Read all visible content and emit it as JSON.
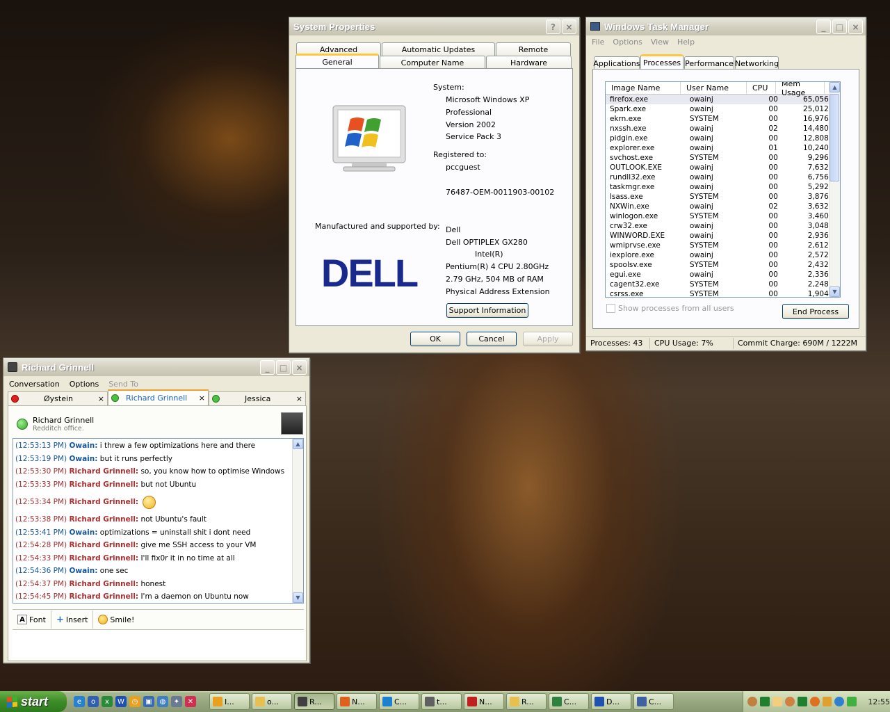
{
  "system_properties": {
    "title": "System Properties",
    "tabs_row1": [
      "Advanced",
      "Automatic Updates",
      "Remote"
    ],
    "tabs_row2": [
      "General",
      "Computer Name",
      "Hardware"
    ],
    "active_tab": "General",
    "system_label": "System:",
    "os_name": "Microsoft Windows XP",
    "os_edition": "Professional",
    "os_version": "Version 2002",
    "os_sp": "Service Pack 3",
    "registered_label": "Registered to:",
    "registered_user": "pccguest",
    "product_id": "76487-OEM-0011903-00102",
    "manufacturer_label": "Manufactured and supported by:",
    "manufacturer": "Dell",
    "model": "Dell OPTIPLEX GX280",
    "cpu_vendor": "Intel(R)",
    "cpu": "Pentium(R) 4 CPU 2.80GHz",
    "ram": "2.79 GHz, 504 MB of RAM",
    "pae": "Physical Address Extension",
    "logo_text": "DELL",
    "support_btn": "Support Information",
    "ok_btn": "OK",
    "cancel_btn": "Cancel",
    "apply_btn": "Apply",
    "help_icon": "?",
    "close_icon": "×"
  },
  "task_manager": {
    "title": "Windows Task Manager",
    "menu": [
      "File",
      "Options",
      "View",
      "Help"
    ],
    "tabs": [
      "Applications",
      "Processes",
      "Performance",
      "Networking"
    ],
    "active_tab": "Processes",
    "columns": [
      "Image Name",
      "User Name",
      "CPU",
      "Mem Usage"
    ],
    "processes": [
      {
        "name": "firefox.exe",
        "user": "owainj",
        "cpu": "00",
        "mem": "65,056 K"
      },
      {
        "name": "Spark.exe",
        "user": "owainj",
        "cpu": "00",
        "mem": "25,012 K"
      },
      {
        "name": "ekrn.exe",
        "user": "SYSTEM",
        "cpu": "00",
        "mem": "16,976 K"
      },
      {
        "name": "nxssh.exe",
        "user": "owainj",
        "cpu": "02",
        "mem": "14,480 K"
      },
      {
        "name": "pidgin.exe",
        "user": "owainj",
        "cpu": "00",
        "mem": "12,808 K"
      },
      {
        "name": "explorer.exe",
        "user": "owainj",
        "cpu": "01",
        "mem": "10,240 K"
      },
      {
        "name": "svchost.exe",
        "user": "SYSTEM",
        "cpu": "00",
        "mem": "9,296 K"
      },
      {
        "name": "OUTLOOK.EXE",
        "user": "owainj",
        "cpu": "00",
        "mem": "7,632 K"
      },
      {
        "name": "rundll32.exe",
        "user": "owainj",
        "cpu": "00",
        "mem": "6,756 K"
      },
      {
        "name": "taskmgr.exe",
        "user": "owainj",
        "cpu": "00",
        "mem": "5,292 K"
      },
      {
        "name": "lsass.exe",
        "user": "SYSTEM",
        "cpu": "00",
        "mem": "3,876 K"
      },
      {
        "name": "NXWin.exe",
        "user": "owainj",
        "cpu": "02",
        "mem": "3,632 K"
      },
      {
        "name": "winlogon.exe",
        "user": "SYSTEM",
        "cpu": "00",
        "mem": "3,460 K"
      },
      {
        "name": "crw32.exe",
        "user": "owainj",
        "cpu": "00",
        "mem": "3,048 K"
      },
      {
        "name": "WINWORD.EXE",
        "user": "owainj",
        "cpu": "00",
        "mem": "2,936 K"
      },
      {
        "name": "wmiprvse.exe",
        "user": "SYSTEM",
        "cpu": "00",
        "mem": "2,612 K"
      },
      {
        "name": "iexplore.exe",
        "user": "owainj",
        "cpu": "00",
        "mem": "2,572 K"
      },
      {
        "name": "spoolsv.exe",
        "user": "SYSTEM",
        "cpu": "00",
        "mem": "2,432 K"
      },
      {
        "name": "egui.exe",
        "user": "owainj",
        "cpu": "00",
        "mem": "2,336 K"
      },
      {
        "name": "cagent32.exe",
        "user": "SYSTEM",
        "cpu": "00",
        "mem": "2,248 K"
      },
      {
        "name": "csrss.exe",
        "user": "SYSTEM",
        "cpu": "00",
        "mem": "1,904 K"
      }
    ],
    "show_all_label": "Show processes from all users",
    "end_process_btn": "End Process",
    "status_processes": "Processes: 43",
    "status_cpu": "CPU Usage: 7%",
    "status_commit": "Commit Charge: 690M / 1222M"
  },
  "chat": {
    "title": "Richard Grinnell",
    "menu": [
      "Conversation",
      "Options",
      "Send To"
    ],
    "tabs": [
      "Øystein",
      "Richard Grinnell",
      "Jessica"
    ],
    "buddy_name": "Richard Grinnell",
    "buddy_status": "Redditch office.",
    "messages": [
      {
        "ts": "(12:53:13 PM)",
        "who": "Owain:",
        "text": " i threw a few optimizations here and there",
        "self": true
      },
      {
        "ts": "(12:53:19 PM)",
        "who": "Owain:",
        "text": " but it runs perfectly",
        "self": true
      },
      {
        "ts": "(12:53:30 PM)",
        "who": "Richard Grinnell:",
        "text": " so, you know how to optimise Windows",
        "self": false
      },
      {
        "ts": "(12:53:33 PM)",
        "who": "Richard Grinnell:",
        "text": " but not Ubuntu",
        "self": false
      },
      {
        "ts": "(12:53:34 PM)",
        "who": "Richard Grinnell:",
        "text": "",
        "self": false,
        "smiley": true
      },
      {
        "ts": "(12:53:38 PM)",
        "who": "Richard Grinnell:",
        "text": " not Ubuntu's fault",
        "self": false
      },
      {
        "ts": "(12:53:41 PM)",
        "who": "Owain:",
        "text": " optimizations = uninstall shit i dont need",
        "self": true
      },
      {
        "ts": "(12:54:28 PM)",
        "who": "Richard Grinnell:",
        "text": " give me SSH access to your VM",
        "self": false
      },
      {
        "ts": "(12:54:33 PM)",
        "who": "Richard Grinnell:",
        "text": " I'll fix0r it in no time at all",
        "self": false
      },
      {
        "ts": "(12:54:36 PM)",
        "who": "Owain:",
        "text": " one sec",
        "self": true
      },
      {
        "ts": "(12:54:37 PM)",
        "who": "Richard Grinnell:",
        "text": " honest",
        "self": false
      },
      {
        "ts": "(12:54:45 PM)",
        "who": "Richard Grinnell:",
        "text": " I'm a daemon on Ubuntu now",
        "self": false
      }
    ],
    "toolbar": {
      "font": "Font",
      "insert": "Insert",
      "smile": "Smile!"
    },
    "tab_close": "×"
  },
  "taskbar": {
    "start_label": "start",
    "tasks": [
      {
        "label": "I...",
        "icon": "clock-icon",
        "color": "#e8a020"
      },
      {
        "label": "o...",
        "icon": "folder-icon",
        "color": "#e8c050"
      },
      {
        "label": "R...",
        "icon": "chat-icon",
        "color": "#404040"
      },
      {
        "label": "N...",
        "icon": "firefox-icon",
        "color": "#e06020"
      },
      {
        "label": "C...",
        "icon": "ie-icon",
        "color": "#2080d0"
      },
      {
        "label": "t...",
        "icon": "network-icon",
        "color": "#606060"
      },
      {
        "label": "N...",
        "icon": "nx-icon",
        "color": "#c02020"
      },
      {
        "label": "R...",
        "icon": "folder-icon",
        "color": "#e8c050"
      },
      {
        "label": "C...",
        "icon": "taskmgr-icon",
        "color": "#308040"
      },
      {
        "label": "D...",
        "icon": "word-icon",
        "color": "#2050b0"
      },
      {
        "label": "C...",
        "icon": "sysprop-icon",
        "color": "#4060a0"
      }
    ],
    "clock": "12:55"
  }
}
